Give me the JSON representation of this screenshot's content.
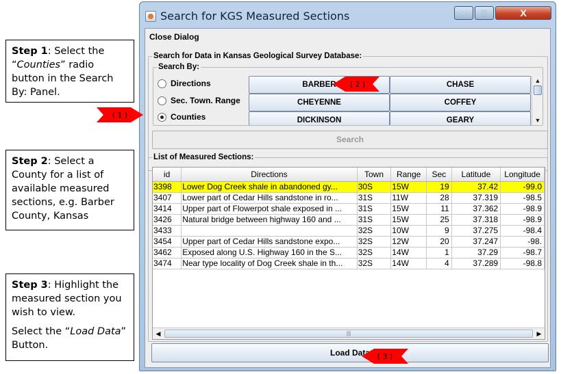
{
  "callouts": {
    "step1": {
      "prefix": "Step 1",
      "text_a": ": Select the “",
      "emph": "Counties",
      "text_b": "” radio button in the Search By: Panel."
    },
    "step2": {
      "prefix": "Step 2",
      "text": ": Select a County for a list of available measured sections, e.g. Barber County, Kansas"
    },
    "step3": {
      "prefix": "Step 3",
      "text": ": Highlight the measured section you wish to view.",
      "line2_a": "Select the “",
      "emph": "Load Data",
      "line2_b": "” Button."
    }
  },
  "markers": {
    "m1": "( 1 )",
    "m2": "( 2 )",
    "m3": "( 3 )"
  },
  "window": {
    "title": "Search for KGS Measured Sections",
    "close_glyph": "X",
    "min_glyph": "–",
    "max_glyph": "□"
  },
  "menu": {
    "close_dialog": "Close Dialog"
  },
  "search_panel": {
    "label": "Search for Data in Kansas Geological Survey Database:",
    "search_by_label": "Search By:",
    "radios": [
      "Directions",
      "Sec. Town. Range",
      "Counties"
    ],
    "selected_radio": "Counties",
    "counties": [
      "BARBER",
      "CHASE",
      "CHEYENNE",
      "COFFEY",
      "DICKINSON",
      "GEARY"
    ],
    "search_button": "Search"
  },
  "list_panel": {
    "label": "List of Measured Sections:",
    "columns": [
      "id",
      "Directions",
      "Town",
      "Range",
      "Sec",
      "Latitude",
      "Longitude"
    ],
    "rows": [
      [
        "3398",
        "Lower Dog Creek shale in abandoned gy...",
        "30S",
        "15W",
        "19",
        "37.42",
        "-99.0"
      ],
      [
        "3407",
        "Lower part of Cedar Hills sandstone in ro...",
        "31S",
        "11W",
        "28",
        "37.319",
        "-98.5"
      ],
      [
        "3414",
        "Upper part of Flowerpot shale exposed in ...",
        "31S",
        "15W",
        "11",
        "37.362",
        "-98.9"
      ],
      [
        "3426",
        "Natural bridge between highway 160 and ...",
        "31S",
        "15W",
        "25",
        "37.318",
        "-98.9"
      ],
      [
        "3433",
        "",
        "32S",
        "10W",
        "9",
        "37.275",
        "-98.4"
      ],
      [
        "3454",
        "Upper part of Cedar Hills sandstone expo...",
        "32S",
        "12W",
        "20",
        "37.247",
        "-98."
      ],
      [
        "3462",
        "Exposed along U.S. Highway 160 in the S...",
        "32S",
        "14W",
        "1",
        "37.29",
        "-98.7"
      ],
      [
        "3474",
        "Near type locality of Dog Creek shale in th...",
        "32S",
        "14W",
        "4",
        "37.289",
        "-98.8"
      ]
    ],
    "selected_row": 0,
    "scroll_grip": "|||",
    "load_button": "Load Data"
  },
  "colors": {
    "highlight": "#ffff00",
    "marker_red": "#ff0000"
  }
}
